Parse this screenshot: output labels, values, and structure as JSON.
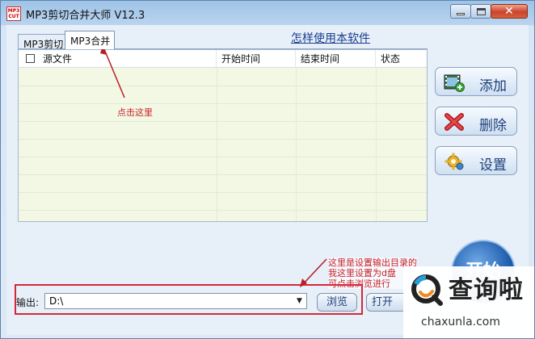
{
  "window": {
    "title": "MP3剪切合并大师 V12.3",
    "logo_text": "MP3 CUT"
  },
  "tabs": [
    {
      "label": "MP3剪切",
      "active": false
    },
    {
      "label": "MP3合并",
      "active": true
    }
  ],
  "help_link": "怎样使用本软件",
  "list": {
    "columns": [
      "源文件",
      "开始时间",
      "结束时间",
      "状态"
    ],
    "rows": []
  },
  "side_buttons": {
    "add": "添加",
    "delete": "删除",
    "settings": "设置"
  },
  "annotations": {
    "click_here": "点击这里",
    "output_note_line1": "这里是设置输出目录的",
    "output_note_line2": "我这里设置为d盘",
    "output_note_line3": "可点击浏览进行"
  },
  "output": {
    "label": "输出:",
    "value": "D:\\"
  },
  "buttons": {
    "browse": "浏览",
    "open": "打开",
    "start": "开始"
  },
  "watermark": {
    "name": "查询啦",
    "domain": "chaxunla.com"
  },
  "colors": {
    "annotation_red": "#c9202a",
    "list_bg": "#f2f8e4",
    "button_text": "#1d3f7a"
  }
}
